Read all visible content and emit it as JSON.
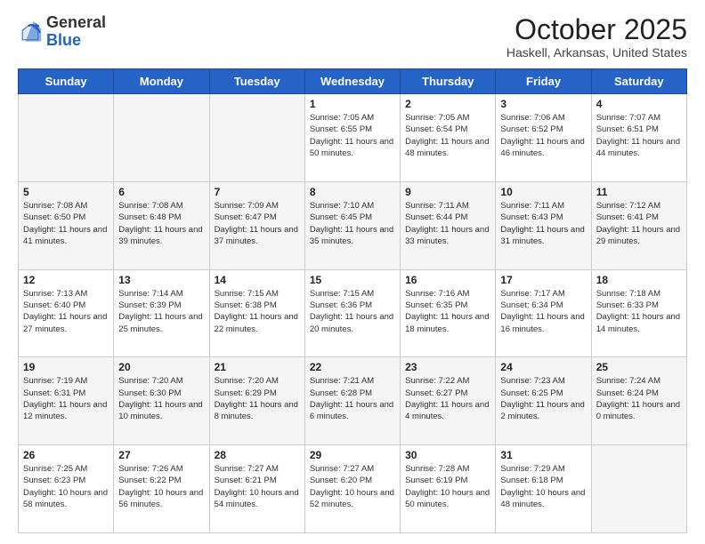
{
  "logo": {
    "general": "General",
    "blue": "Blue"
  },
  "header": {
    "month": "October 2025",
    "location": "Haskell, Arkansas, United States"
  },
  "days_of_week": [
    "Sunday",
    "Monday",
    "Tuesday",
    "Wednesday",
    "Thursday",
    "Friday",
    "Saturday"
  ],
  "weeks": [
    [
      {
        "day": "",
        "empty": true
      },
      {
        "day": "",
        "empty": true
      },
      {
        "day": "",
        "empty": true
      },
      {
        "day": "1",
        "sunrise": "7:05 AM",
        "sunset": "6:55 PM",
        "daylight": "11 hours and 50 minutes."
      },
      {
        "day": "2",
        "sunrise": "7:05 AM",
        "sunset": "6:54 PM",
        "daylight": "11 hours and 48 minutes."
      },
      {
        "day": "3",
        "sunrise": "7:06 AM",
        "sunset": "6:52 PM",
        "daylight": "11 hours and 46 minutes."
      },
      {
        "day": "4",
        "sunrise": "7:07 AM",
        "sunset": "6:51 PM",
        "daylight": "11 hours and 44 minutes."
      }
    ],
    [
      {
        "day": "5",
        "sunrise": "7:08 AM",
        "sunset": "6:50 PM",
        "daylight": "11 hours and 41 minutes."
      },
      {
        "day": "6",
        "sunrise": "7:08 AM",
        "sunset": "6:48 PM",
        "daylight": "11 hours and 39 minutes."
      },
      {
        "day": "7",
        "sunrise": "7:09 AM",
        "sunset": "6:47 PM",
        "daylight": "11 hours and 37 minutes."
      },
      {
        "day": "8",
        "sunrise": "7:10 AM",
        "sunset": "6:45 PM",
        "daylight": "11 hours and 35 minutes."
      },
      {
        "day": "9",
        "sunrise": "7:11 AM",
        "sunset": "6:44 PM",
        "daylight": "11 hours and 33 minutes."
      },
      {
        "day": "10",
        "sunrise": "7:11 AM",
        "sunset": "6:43 PM",
        "daylight": "11 hours and 31 minutes."
      },
      {
        "day": "11",
        "sunrise": "7:12 AM",
        "sunset": "6:41 PM",
        "daylight": "11 hours and 29 minutes."
      }
    ],
    [
      {
        "day": "12",
        "sunrise": "7:13 AM",
        "sunset": "6:40 PM",
        "daylight": "11 hours and 27 minutes."
      },
      {
        "day": "13",
        "sunrise": "7:14 AM",
        "sunset": "6:39 PM",
        "daylight": "11 hours and 25 minutes."
      },
      {
        "day": "14",
        "sunrise": "7:15 AM",
        "sunset": "6:38 PM",
        "daylight": "11 hours and 22 minutes."
      },
      {
        "day": "15",
        "sunrise": "7:15 AM",
        "sunset": "6:36 PM",
        "daylight": "11 hours and 20 minutes."
      },
      {
        "day": "16",
        "sunrise": "7:16 AM",
        "sunset": "6:35 PM",
        "daylight": "11 hours and 18 minutes."
      },
      {
        "day": "17",
        "sunrise": "7:17 AM",
        "sunset": "6:34 PM",
        "daylight": "11 hours and 16 minutes."
      },
      {
        "day": "18",
        "sunrise": "7:18 AM",
        "sunset": "6:33 PM",
        "daylight": "11 hours and 14 minutes."
      }
    ],
    [
      {
        "day": "19",
        "sunrise": "7:19 AM",
        "sunset": "6:31 PM",
        "daylight": "11 hours and 12 minutes."
      },
      {
        "day": "20",
        "sunrise": "7:20 AM",
        "sunset": "6:30 PM",
        "daylight": "11 hours and 10 minutes."
      },
      {
        "day": "21",
        "sunrise": "7:20 AM",
        "sunset": "6:29 PM",
        "daylight": "11 hours and 8 minutes."
      },
      {
        "day": "22",
        "sunrise": "7:21 AM",
        "sunset": "6:28 PM",
        "daylight": "11 hours and 6 minutes."
      },
      {
        "day": "23",
        "sunrise": "7:22 AM",
        "sunset": "6:27 PM",
        "daylight": "11 hours and 4 minutes."
      },
      {
        "day": "24",
        "sunrise": "7:23 AM",
        "sunset": "6:25 PM",
        "daylight": "11 hours and 2 minutes."
      },
      {
        "day": "25",
        "sunrise": "7:24 AM",
        "sunset": "6:24 PM",
        "daylight": "11 hours and 0 minutes."
      }
    ],
    [
      {
        "day": "26",
        "sunrise": "7:25 AM",
        "sunset": "6:23 PM",
        "daylight": "10 hours and 58 minutes."
      },
      {
        "day": "27",
        "sunrise": "7:26 AM",
        "sunset": "6:22 PM",
        "daylight": "10 hours and 56 minutes."
      },
      {
        "day": "28",
        "sunrise": "7:27 AM",
        "sunset": "6:21 PM",
        "daylight": "10 hours and 54 minutes."
      },
      {
        "day": "29",
        "sunrise": "7:27 AM",
        "sunset": "6:20 PM",
        "daylight": "10 hours and 52 minutes."
      },
      {
        "day": "30",
        "sunrise": "7:28 AM",
        "sunset": "6:19 PM",
        "daylight": "10 hours and 50 minutes."
      },
      {
        "day": "31",
        "sunrise": "7:29 AM",
        "sunset": "6:18 PM",
        "daylight": "10 hours and 48 minutes."
      },
      {
        "day": "",
        "empty": true
      }
    ]
  ]
}
